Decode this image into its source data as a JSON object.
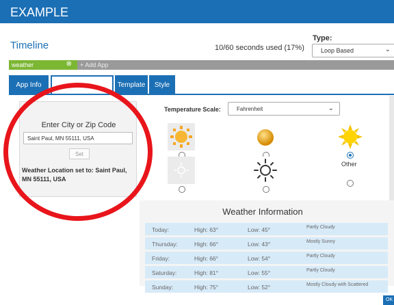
{
  "header": {
    "title": "EXAMPLE"
  },
  "timeline": {
    "title": "Timeline",
    "usage": "10/60 seconds used (17%)",
    "type_label": "Type:",
    "type_value": "Loop Based"
  },
  "app_bar": {
    "active_app": "weather",
    "add_app": "+ Add App"
  },
  "tabs": [
    {
      "label": "App Info"
    },
    {
      "label": ""
    },
    {
      "label": "Template"
    },
    {
      "label": "Style"
    }
  ],
  "location_panel": {
    "heading": "Enter City or Zip Code",
    "input_value": "Saint Paul, MN 55111, USA",
    "set_label": "Set",
    "status": "Weather Location set to: Saint Paul, MN 55111, USA"
  },
  "temperature": {
    "label": "Temperature Scale:",
    "value": "Fahrenheit"
  },
  "icon_options": {
    "other_label": "Other",
    "selected_index": 2,
    "icons": [
      "sun-pixel-icon",
      "sun-glossy-icon",
      "sun-yellow-icon",
      "sun-faint-icon",
      "sun-outline-icon",
      "blank-icon"
    ]
  },
  "weather_info": {
    "title": "Weather Information",
    "rows": [
      {
        "day": "Today:",
        "high": "High: 63°",
        "low": "Low: 45°",
        "cond": "Partly Cloudy"
      },
      {
        "day": "Thursday:",
        "high": "High: 66°",
        "low": "Low: 43°",
        "cond": "Mostly Sunny"
      },
      {
        "day": "Friday:",
        "high": "High: 66°",
        "low": "Low: 54°",
        "cond": "Partly Cloudy"
      },
      {
        "day": "Saturday:",
        "high": "High: 81°",
        "low": "Low: 55°",
        "cond": "Partly Cloudy"
      },
      {
        "day": "Sunday:",
        "high": "High: 75°",
        "low": "Low: 52°",
        "cond": "Mostly Cloudy with Scattered"
      }
    ]
  },
  "footer": {
    "ok_label": "OK"
  },
  "colors": {
    "primary": "#1b6fb5",
    "app_chip": "#7cb734",
    "highlight_circle": "#e8151b",
    "row_bg": "#d7eaf8"
  }
}
